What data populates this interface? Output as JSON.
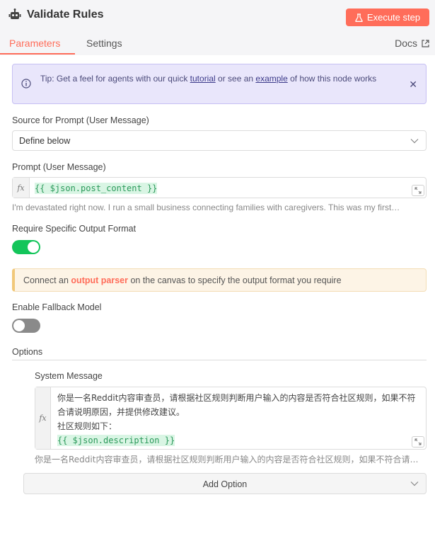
{
  "header": {
    "title": "Validate Rules",
    "execute_label": "Execute step",
    "tabs": [
      {
        "label": "Parameters"
      },
      {
        "label": "Settings"
      }
    ],
    "docs_label": "Docs"
  },
  "tip": {
    "prefix": "Tip: Get a feel for agents with our quick ",
    "link1": "tutorial",
    "middle": " or see an ",
    "link2": "example",
    "suffix": " of how this node works"
  },
  "source": {
    "label": "Source for Prompt (User Message)",
    "value": "Define below"
  },
  "prompt": {
    "label": "Prompt (User Message)",
    "fx": "fx",
    "expression": "{{ $json.post_content }}",
    "preview": "I'm devastated right now. I run a small business connecting families with caregivers. This was my first…"
  },
  "output_format": {
    "label": "Require Specific Output Format",
    "enabled": true
  },
  "notice": {
    "prefix": "Connect an ",
    "link": "output parser",
    "suffix": " on the canvas to specify the output format you require"
  },
  "fallback": {
    "label": "Enable Fallback Model",
    "enabled": false
  },
  "options": {
    "label": "Options",
    "system_message": {
      "label": "System Message",
      "fx": "fx",
      "line1": "你是一名Reddit内容审查员，请根据社区规则判断用户输入的内容是否符合社区规则，如果不符合请说明原因，并提供修改建议。",
      "line2": "社区规则如下：",
      "expression": "{{ $json.description }}",
      "preview": "你是一名Reddit内容审查员，请根据社区规则判断用户输入的内容是否符合社区规则，如果不符合请说…"
    },
    "add_option_label": "Add Option"
  },
  "colors": {
    "accent": "#ff6d5a",
    "toggle_on": "#13c55a",
    "tip_bg": "#e9e6fb"
  }
}
